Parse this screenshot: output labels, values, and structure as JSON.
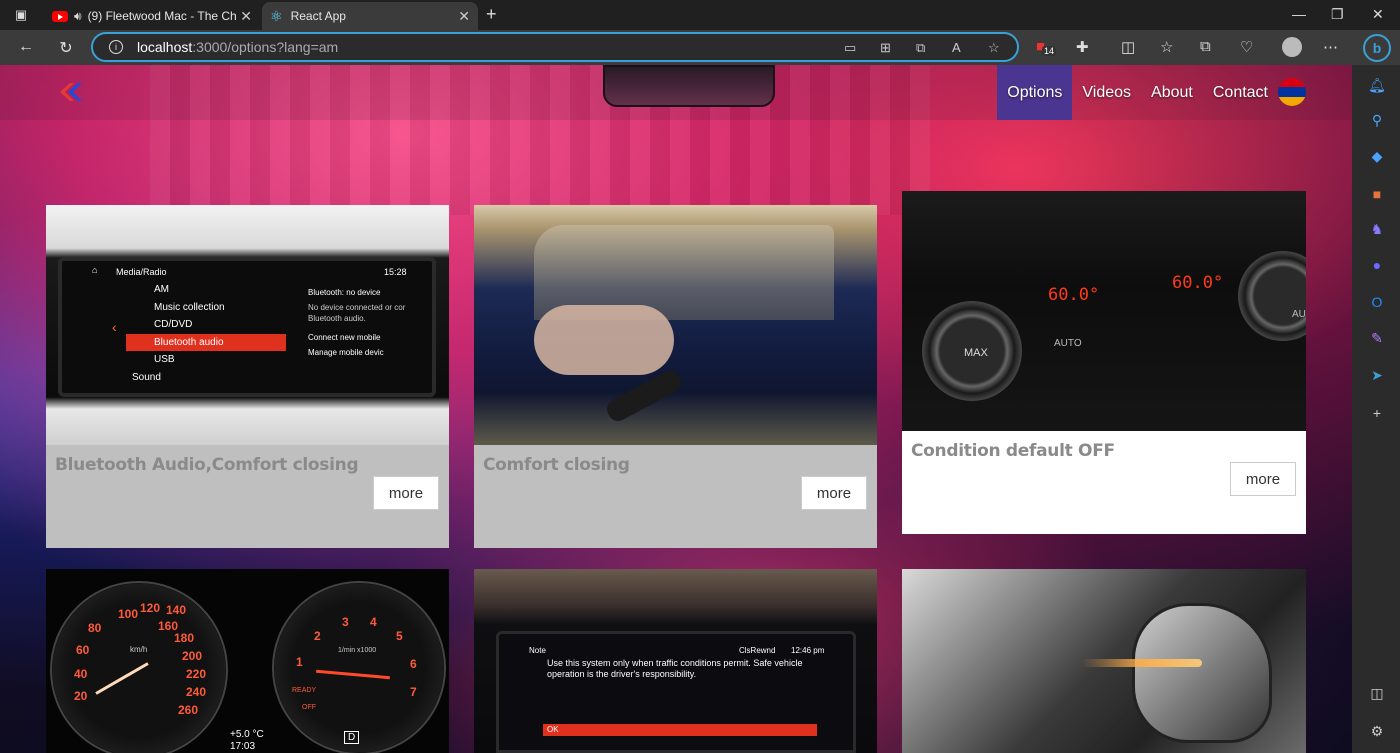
{
  "browser": {
    "tabs": [
      {
        "title": "(9) Fleetwood Mac - The Ch",
        "icon": "youtube-icon",
        "audio": true
      },
      {
        "title": "React App",
        "icon": "react-icon",
        "active": true
      }
    ],
    "address": {
      "host": "localhost",
      "path": ":3000/options?lang=am"
    },
    "badge_count": "14"
  },
  "site": {
    "menu": [
      {
        "label": "Options",
        "active": true
      },
      {
        "label": "Videos",
        "active": false
      },
      {
        "label": "About",
        "active": false
      },
      {
        "label": "Contact",
        "active": false
      }
    ],
    "flag_colors": [
      "#d90012",
      "#0033a0",
      "#f2a800"
    ],
    "cards": [
      {
        "title": "Bluetooth Audio,Comfort closing",
        "more": "more",
        "screen": {
          "header": "Media/Radio",
          "time": "15:28",
          "items": [
            "AM",
            "Music collection",
            "CD/DVD",
            "Bluetooth audio",
            "USB",
            "Sound"
          ],
          "right_title": "Bluetooth: no device",
          "right_text": "No device connected or cor Bluetooth audio.",
          "right_items": [
            "Connect new mobile",
            "Manage mobile devic"
          ]
        }
      },
      {
        "title": "Comfort closing",
        "more": "more"
      },
      {
        "title": "Condition default OFF",
        "more": "more",
        "climate": {
          "left": "60.0°",
          "right": "60.0°",
          "max": "MAX",
          "auto": "AUTO",
          "auto_right": "AU"
        }
      },
      {
        "title": "",
        "gauges": {
          "speed_unit": "km/h",
          "rpm_unit": "1/min x1000",
          "speed_labels": [
            "20",
            "40",
            "60",
            "80",
            "100",
            "120",
            "140",
            "160",
            "180",
            "200",
            "220",
            "240",
            "260"
          ],
          "rpm_labels": [
            "1",
            "2",
            "3",
            "4",
            "5",
            "6",
            "7"
          ],
          "temp": "+5.0 °C",
          "clock": "17:03",
          "gear": "D",
          "ready": "READY",
          "off": "OFF"
        }
      },
      {
        "title": "",
        "note": {
          "header": "Note",
          "time": "12:46 pm",
          "tag": "ClsRewnd",
          "text": "Use this system only when traffic conditions permit. Safe vehicle operation is the driver's responsibility.",
          "ok": "OK"
        }
      },
      {
        "title": ""
      }
    ]
  }
}
